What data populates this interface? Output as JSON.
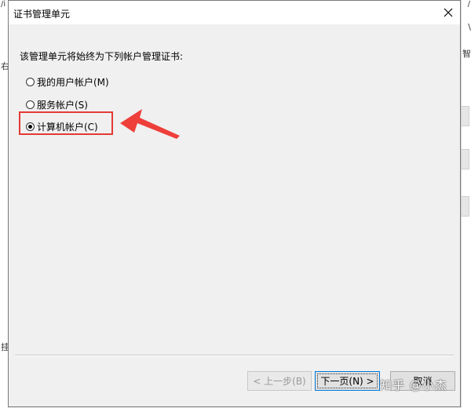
{
  "background": {
    "top_left_fragment": "/i",
    "top_right_fragment": "/",
    "right_fragment": "\\",
    "left_fragment_1": "右",
    "left_fragment_2": "挂",
    "right_fragment_2": "智"
  },
  "dialog": {
    "title": "证书管理单元",
    "prompt": "该管理单元将始终为下列帐户管理证书:",
    "options": [
      {
        "label": "我的用户帐户(M)",
        "checked": false
      },
      {
        "label": "服务帐户(S)",
        "checked": false
      },
      {
        "label": "计算机帐户(C)",
        "checked": true
      }
    ],
    "buttons": {
      "prev": "< 上一步(B)",
      "next": "下一页(N) >",
      "cancel": "取消"
    }
  },
  "annotation": {
    "highlight_color": "#e53935"
  },
  "watermark": "知乎 @小杰"
}
